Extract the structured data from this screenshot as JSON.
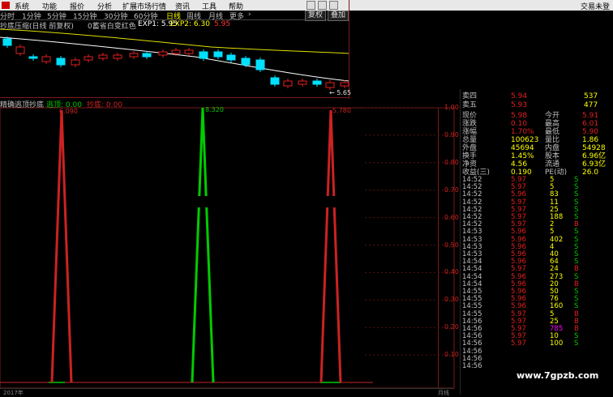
{
  "menu": {
    "items": [
      "系统",
      "功能",
      "报价",
      "分析",
      "扩展市场行情",
      "资讯",
      "工具",
      "帮助"
    ],
    "right": "交易未登"
  },
  "periods": {
    "items": [
      "分时",
      "1分钟",
      "5分钟",
      "15分钟",
      "30分钟",
      "60分钟",
      "日线",
      "周线",
      "月线",
      "更多",
      "›"
    ],
    "active": "日线"
  },
  "buttons": {
    "restore": "复权",
    "overlay": "叠加"
  },
  "formula": {
    "name": "抄底压缩(日线 前复权)",
    "theme": "0蓄省白变红色",
    "exp1": "EXP1: 5.95",
    "exp2": "EXP2: 6.30",
    "val": "5.95"
  },
  "price_label": "← 5.65",
  "indicator": {
    "name": "精确逃顶抄底",
    "l1": "逃顶: 0.00",
    "l2": "抄底: 0.00"
  },
  "peaks": {
    "p1": "6.090",
    "p2": "8.320",
    "p3": "5.780"
  },
  "axis": {
    "labels": [
      "1.00",
      "0.90",
      "0.80",
      "0.70",
      "0.60",
      "0.50",
      "0.40",
      "0.30",
      "0.20",
      "0.10"
    ]
  },
  "footer": {
    "year": "2017年",
    "month": "月线"
  },
  "quote": {
    "sell": [
      {
        "label": "卖四",
        "price": "5.94",
        "vol": "537"
      },
      {
        "label": "卖五",
        "price": "5.93",
        "vol": "477"
      }
    ],
    "stats": [
      {
        "l1": "现价",
        "v1": "5.98",
        "l2": "今开",
        "v2": "5.91"
      },
      {
        "l1": "涨跌",
        "v1": "0.10",
        "l2": "最高",
        "v2": "6.01"
      },
      {
        "l1": "涨幅",
        "v1": "1.70%",
        "l2": "最低",
        "v2": "5.90"
      },
      {
        "l1": "总量",
        "v1": "100623",
        "l2": "量比",
        "v2": "1.86"
      },
      {
        "l1": "外盘",
        "v1": "45694",
        "l2": "内盘",
        "v2": "54928"
      },
      {
        "l1": "换手",
        "v1": "1.45%",
        "l2": "股本",
        "v2": "6.96亿"
      },
      {
        "l1": "净资",
        "v1": "4.56",
        "l2": "流通",
        "v2": "6.93亿"
      },
      {
        "l1": "收益(三)",
        "v1": "0.190",
        "l2": "PE(动)",
        "v2": "26.0"
      }
    ]
  },
  "ticks": [
    {
      "t": "14:52",
      "p": "5.97",
      "v": "5",
      "f": "S"
    },
    {
      "t": "14:52",
      "p": "5.97",
      "v": "5",
      "f": "S"
    },
    {
      "t": "14:52",
      "p": "5.96",
      "v": "83",
      "f": "S"
    },
    {
      "t": "14:52",
      "p": "5.97",
      "v": "11",
      "f": "S"
    },
    {
      "t": "14:52",
      "p": "5.97",
      "v": "25",
      "f": "S"
    },
    {
      "t": "14:52",
      "p": "5.97",
      "v": "188",
      "f": "S"
    },
    {
      "t": "14:52",
      "p": "5.97",
      "v": "2",
      "f": "B"
    },
    {
      "t": "14:53",
      "p": "5.96",
      "v": "5",
      "f": "S"
    },
    {
      "t": "14:53",
      "p": "5.96",
      "v": "402",
      "f": "S"
    },
    {
      "t": "14:53",
      "p": "5.96",
      "v": "4",
      "f": "S"
    },
    {
      "t": "14:53",
      "p": "5.96",
      "v": "40",
      "f": "S"
    },
    {
      "t": "14:54",
      "p": "5.96",
      "v": "64",
      "f": "S"
    },
    {
      "t": "14:54",
      "p": "5.97",
      "v": "24",
      "f": "B"
    },
    {
      "t": "14:54",
      "p": "5.96",
      "v": "273",
      "f": "S"
    },
    {
      "t": "14:54",
      "p": "5.96",
      "v": "20",
      "f": "B"
    },
    {
      "t": "14:55",
      "p": "5.96",
      "v": "50",
      "f": "S"
    },
    {
      "t": "14:55",
      "p": "5.96",
      "v": "76",
      "f": "S"
    },
    {
      "t": "14:55",
      "p": "5.96",
      "v": "160",
      "f": "S"
    },
    {
      "t": "14:55",
      "p": "5.97",
      "v": "5",
      "f": "B"
    },
    {
      "t": "14:56",
      "p": "5.97",
      "v": "25",
      "f": "B"
    },
    {
      "t": "14:56",
      "p": "5.97",
      "v": "785",
      "f": "B"
    },
    {
      "t": "14:56",
      "p": "5.97",
      "v": "10",
      "f": "S"
    },
    {
      "t": "14:56",
      "p": "5.97",
      "v": "100",
      "f": "S"
    },
    {
      "t": "14:56",
      "p": "",
      "v": "",
      "f": ""
    },
    {
      "t": "14:56",
      "p": "",
      "v": "",
      "f": ""
    },
    {
      "t": "14:56",
      "p": "",
      "v": "",
      "f": ""
    }
  ],
  "watermark": "www.7gpzb.com",
  "colors": {
    "up": "#e02020",
    "down": "#00e0ff",
    "green": "#00cc00",
    "ma1": "#ffffff",
    "ma2": "#e0e000"
  },
  "chart_data": [
    {
      "type": "line",
      "series": [
        {
          "name": "逃顶",
          "color": "#cc2222"
        },
        {
          "name": "抄底",
          "color": "#00cc00"
        }
      ],
      "ylim": [
        0,
        1
      ],
      "peaks": [
        {
          "series": "逃顶",
          "label": "6.090",
          "value": 1.0
        },
        {
          "series": "抄底",
          "label": "8.320",
          "value": 1.0
        },
        {
          "series": "逃顶",
          "label": "5.780",
          "value": 1.0
        }
      ]
    }
  ]
}
